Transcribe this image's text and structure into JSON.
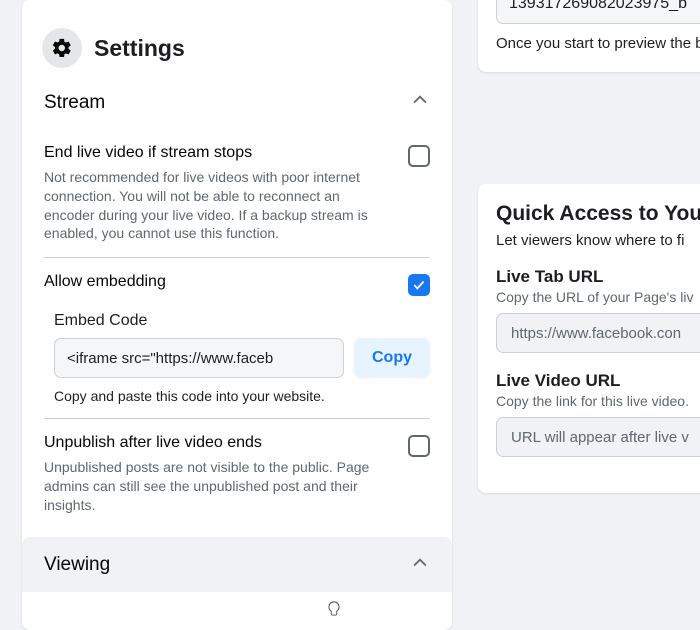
{
  "settings": {
    "title": "Settings",
    "stream": {
      "label": "Stream",
      "end_if_stops": {
        "label": "End live video if stream stops",
        "desc": "Not recommended for live videos with poor internet connection. You will not be able to reconnect an encoder during your live video. If a backup stream is enabled, you cannot use this function.",
        "checked": false
      },
      "allow_embedding": {
        "label": "Allow embedding",
        "checked": true
      },
      "embed_code": {
        "label": "Embed Code",
        "value": "<iframe src=\"https://www.faceb",
        "copy_label": "Copy",
        "hint": "Copy and paste this code into your website."
      },
      "unpublish": {
        "label": "Unpublish after live video ends",
        "desc": "Unpublished posts are not visible to the public. Page admins can still see the unpublished post and their insights.",
        "checked": false
      }
    },
    "viewing": {
      "label": "Viewing"
    }
  },
  "right_top": {
    "code_value": "139317269082023975_b",
    "desc": "Once you start to preview the br go live."
  },
  "quick_access": {
    "title": "Quick Access to You",
    "subtitle": "Let viewers know where to fi",
    "live_tab": {
      "label": "Live Tab URL",
      "desc": "Copy the URL of your Page's liv",
      "value": "https://www.facebook.con"
    },
    "live_video": {
      "label": "Live Video URL",
      "desc": "Copy the link for this live video.",
      "value": "URL will appear after live v"
    }
  }
}
